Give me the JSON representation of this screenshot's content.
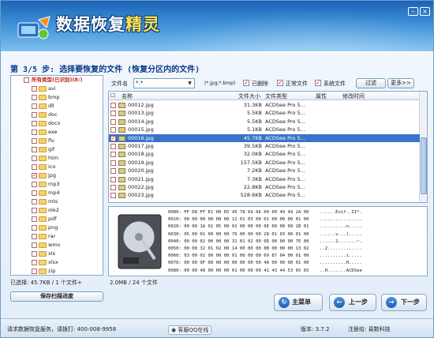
{
  "app": {
    "title_a": "数据恢复",
    "title_b": "精灵",
    "min_glyph": "–",
    "close_glyph": "×"
  },
  "step": "第 3/5 步: 选择要恢复的文件 (恢复分区内的文件)",
  "tree": {
    "root": "所有类型(已识别)(8:)",
    "items": [
      "avi",
      "bmp",
      "dll",
      "doc",
      "docx",
      "exe",
      "flv",
      "gif",
      "htm",
      "ico",
      "jpg",
      "mp3",
      "mp4",
      "mts",
      "ole2",
      "pdf",
      "png",
      "rar",
      "wmv",
      "xls",
      "xlsx",
      "zip"
    ],
    "checked_index": 10
  },
  "toolbar": {
    "filename_label": "文件名",
    "filename_value": "*.*",
    "ext_hint": "(*.jpg;*.bmp)",
    "deleted": "已删除",
    "normal": "正常文件",
    "system": "系统文件",
    "filter_button": "过滤",
    "more_button": "更多>>",
    "check_mark": "✓"
  },
  "grid": {
    "columns": {
      "name": "名称",
      "size": "文件大小",
      "type": "文件类型",
      "attr": "属性",
      "mtime": "修改时间"
    },
    "rows": [
      {
        "name": "00012.jpg",
        "size": "31.3KB",
        "type": "ACDSee Pro 5..."
      },
      {
        "name": "00013.jpg",
        "size": "5.5KB",
        "type": "ACDSee Pro 5..."
      },
      {
        "name": "00014.jpg",
        "size": "5.5KB",
        "type": "ACDSee Pro 5..."
      },
      {
        "name": "00015.jpg",
        "size": "5.1KB",
        "type": "ACDSee Pro 5..."
      },
      {
        "name": "00016.jpg",
        "size": "45.7KB",
        "type": "ACDSee Pro 5..."
      },
      {
        "name": "00017.jpg",
        "size": "39.5KB",
        "type": "ACDSee Pro 5..."
      },
      {
        "name": "00018.jpg",
        "size": "32.0KB",
        "type": "ACDSee Pro 5..."
      },
      {
        "name": "00019.jpg",
        "size": "157.5KB",
        "type": "ACDSee Pro 5..."
      },
      {
        "name": "00020.jpg",
        "size": "7.2KB",
        "type": "ACDSee Pro 5..."
      },
      {
        "name": "00021.jpg",
        "size": "7.3KB",
        "type": "ACDSee Pro 5..."
      },
      {
        "name": "00022.jpg",
        "size": "22.8KB",
        "type": "ACDSee Pro 5..."
      },
      {
        "name": "00023.jpg",
        "size": "528.6KB",
        "type": "ACDSee Pro 5..."
      }
    ],
    "selected_index": 4
  },
  "hex": [
    "0000: FF D8 FF E1 00 D5 45 78 69 66 00 00 49 49 2A 00    ......Exif..II*.",
    "0010: 08 00 00 00 08 00 12 01 03 00 01 00 00 00 01 00    ................",
    "0020: 00 00 1A 01 05 00 01 00 00 00 6E 00 00 00 1B 01    ..........n.....",
    "0030: 05 00 01 00 00 00 76 00 00 00 28 01 03 00 01 00    ......v...(.....",
    "0040: 00 00 02 00 00 00 31 01 02 00 0D 00 00 00 7E 00    ......1.......~.",
    "0050: 00 00 32 01 02 00 14 00 00 00 8B 00 00 00 13 02    ..2.............",
    "0060: 03 00 01 00 00 00 01 00 00 00 69 87 04 00 01 00    ..........i.....",
    "0070: 00 00 9F 00 00 00 00 00 00 00 48 00 00 00 01 00    ..........H.....",
    "0080: 00 00 48 00 00 00 01 00 00 00 41 43 44 53 65 65    ..H.......ACDSee"
  ],
  "status": {
    "selected": "已选择: 45.7KB / 1 个文件+",
    "total": "2.0MB / 24 个文件"
  },
  "save_button": "保存扫描进度",
  "nav": {
    "main": "主菜单",
    "prev": "上一步",
    "next": "下一步",
    "home_glyph": "↻",
    "prev_glyph": "←",
    "next_glyph": "→"
  },
  "footer": {
    "hotline": "请求数据恢复服务，请拨打: 400-008-9958",
    "qq": "客服QQ在线",
    "version": "版本: 3.7.2",
    "reg": "注册给: 易数科技"
  }
}
